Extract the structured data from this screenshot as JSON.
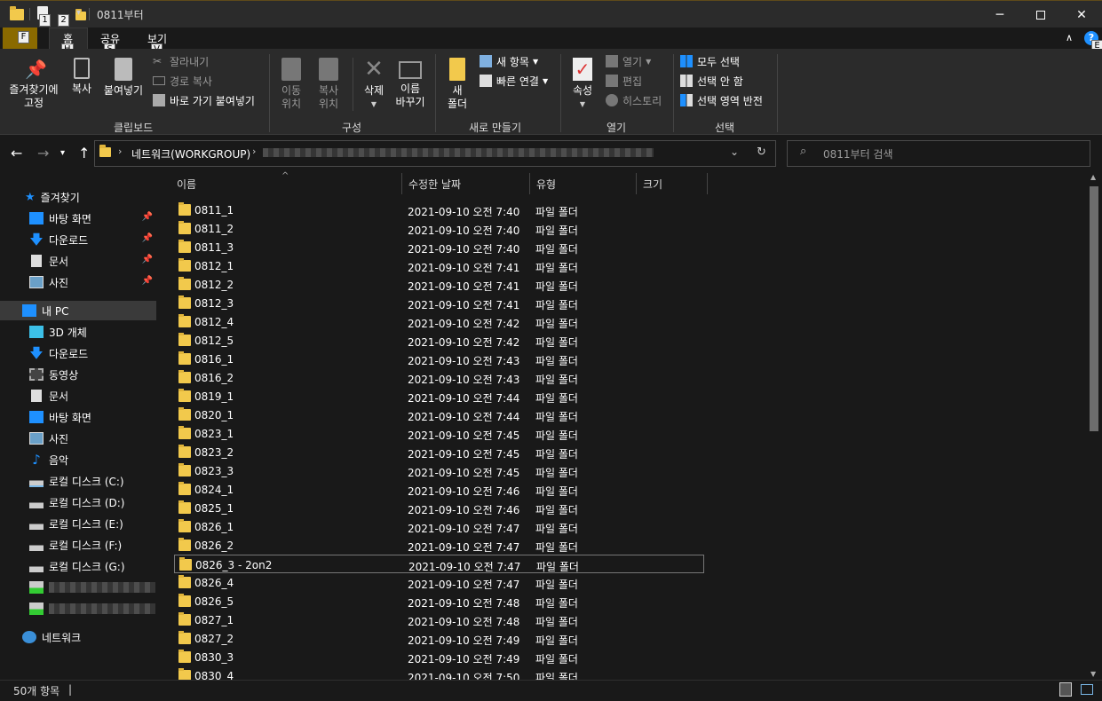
{
  "window": {
    "title": "0811부터",
    "quick_access_keytips": [
      "1",
      "2"
    ],
    "controls": [
      "minimize",
      "maximize",
      "close"
    ]
  },
  "ribbon_tabs": [
    {
      "label": "",
      "keytip": "F"
    },
    {
      "label": "홈",
      "keytip": "H"
    },
    {
      "label": "공유",
      "keytip": "S"
    },
    {
      "label": "보기",
      "keytip": "V"
    }
  ],
  "ribbon_keytip_e": "E",
  "ribbon": {
    "clipboard": {
      "label": "클립보드",
      "pin_quick_access": "즐겨찾기에\n고정",
      "copy": "복사",
      "paste": "붙여넣기",
      "cut": "잘라내기",
      "copy_path": "경로 복사",
      "paste_shortcut": "바로 가기 붙여넣기"
    },
    "organize": {
      "label": "구성",
      "move_to": "이동\n위치",
      "copy_to": "복사\n위치",
      "delete": "삭제",
      "rename": "이름\n바꾸기"
    },
    "new": {
      "label": "새로 만들기",
      "new_folder": "새\n폴더",
      "new_item": "새 항목",
      "easy_access": "빠른 연결"
    },
    "open": {
      "label": "열기",
      "properties": "속성",
      "open": "열기",
      "edit": "편집",
      "history": "히스토리"
    },
    "select": {
      "label": "선택",
      "select_all": "모두 선택",
      "select_none": "선택 안 함",
      "invert": "선택 영역 반전"
    }
  },
  "address": {
    "root": "네트워크(WORKGROUP)",
    "search_placeholder": "0811부터 검색"
  },
  "nav": {
    "quick_access": "즐겨찾기",
    "quick_items": [
      "바탕 화면",
      "다운로드",
      "문서",
      "사진"
    ],
    "this_pc": "내 PC",
    "pc_items": [
      "3D 개체",
      "다운로드",
      "동영상",
      "문서",
      "바탕 화면",
      "사진",
      "음악",
      "로컬 디스크 (C:)",
      "로컬 디스크 (D:)",
      "로컬 디스크 (E:)",
      "로컬 디스크 (F:)",
      "로컬 디스크 (G:)"
    ],
    "network": "네트워크"
  },
  "columns": {
    "name": "이름",
    "modified": "수정한 날짜",
    "type": "유형",
    "size": "크기"
  },
  "files": [
    {
      "name": "0811_1",
      "date": "2021-09-10 오전 7:40",
      "type": "파일 폴더"
    },
    {
      "name": "0811_2",
      "date": "2021-09-10 오전 7:40",
      "type": "파일 폴더"
    },
    {
      "name": "0811_3",
      "date": "2021-09-10 오전 7:40",
      "type": "파일 폴더"
    },
    {
      "name": "0812_1",
      "date": "2021-09-10 오전 7:41",
      "type": "파일 폴더"
    },
    {
      "name": "0812_2",
      "date": "2021-09-10 오전 7:41",
      "type": "파일 폴더"
    },
    {
      "name": "0812_3",
      "date": "2021-09-10 오전 7:41",
      "type": "파일 폴더"
    },
    {
      "name": "0812_4",
      "date": "2021-09-10 오전 7:42",
      "type": "파일 폴더"
    },
    {
      "name": "0812_5",
      "date": "2021-09-10 오전 7:42",
      "type": "파일 폴더"
    },
    {
      "name": "0816_1",
      "date": "2021-09-10 오전 7:43",
      "type": "파일 폴더"
    },
    {
      "name": "0816_2",
      "date": "2021-09-10 오전 7:43",
      "type": "파일 폴더"
    },
    {
      "name": "0819_1",
      "date": "2021-09-10 오전 7:44",
      "type": "파일 폴더"
    },
    {
      "name": "0820_1",
      "date": "2021-09-10 오전 7:44",
      "type": "파일 폴더"
    },
    {
      "name": "0823_1",
      "date": "2021-09-10 오전 7:45",
      "type": "파일 폴더"
    },
    {
      "name": "0823_2",
      "date": "2021-09-10 오전 7:45",
      "type": "파일 폴더"
    },
    {
      "name": "0823_3",
      "date": "2021-09-10 오전 7:45",
      "type": "파일 폴더"
    },
    {
      "name": "0824_1",
      "date": "2021-09-10 오전 7:46",
      "type": "파일 폴더"
    },
    {
      "name": "0825_1",
      "date": "2021-09-10 오전 7:46",
      "type": "파일 폴더"
    },
    {
      "name": "0826_1",
      "date": "2021-09-10 오전 7:47",
      "type": "파일 폴더"
    },
    {
      "name": "0826_2",
      "date": "2021-09-10 오전 7:47",
      "type": "파일 폴더"
    },
    {
      "name": "0826_3 - 2on2",
      "date": "2021-09-10 오전 7:47",
      "type": "파일 폴더",
      "focused": true
    },
    {
      "name": "0826_4",
      "date": "2021-09-10 오전 7:47",
      "type": "파일 폴더"
    },
    {
      "name": "0826_5",
      "date": "2021-09-10 오전 7:48",
      "type": "파일 폴더"
    },
    {
      "name": "0827_1",
      "date": "2021-09-10 오전 7:48",
      "type": "파일 폴더"
    },
    {
      "name": "0827_2",
      "date": "2021-09-10 오전 7:49",
      "type": "파일 폴더"
    },
    {
      "name": "0830_3",
      "date": "2021-09-10 오전 7:49",
      "type": "파일 폴더"
    },
    {
      "name": "0830_4",
      "date": "2021-09-10 오전 7:50",
      "type": "파일 폴더"
    }
  ],
  "status": {
    "count": "50개 항목"
  },
  "colors": {
    "background": "#191919",
    "ribbon": "#2b2b2b",
    "folder": "#f2c94c",
    "file_tab": "#8a6a00",
    "accent_blue": "#1e90ff"
  }
}
